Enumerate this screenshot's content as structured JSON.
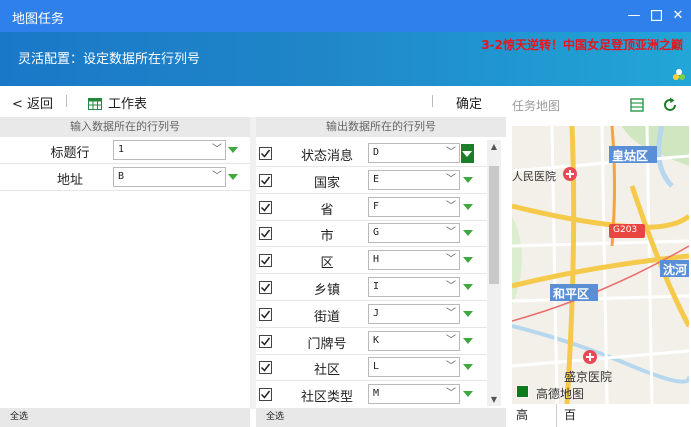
{
  "window": {
    "title": "地图任务"
  },
  "banner": {
    "subtitle": "灵活配置：设定数据所在行列号",
    "news": "3-2惊天逆转！中国女足登顶亚洲之巅"
  },
  "toolbar": {
    "back": "< 返回",
    "sheet": "工作表",
    "confirm": "确定"
  },
  "input": {
    "header": "输入数据所在的行列号",
    "rows": [
      {
        "label": "标题行",
        "value": "1"
      },
      {
        "label": "地址",
        "value": "B"
      }
    ],
    "footer": "全选"
  },
  "output": {
    "header": "输出数据所在的行列号",
    "rows": [
      {
        "label": "状态消息",
        "value": "D"
      },
      {
        "label": "国家",
        "value": "E"
      },
      {
        "label": "省",
        "value": "F"
      },
      {
        "label": "市",
        "value": "G"
      },
      {
        "label": "区",
        "value": "H"
      },
      {
        "label": "乡镇",
        "value": "I"
      },
      {
        "label": "街道",
        "value": "J"
      },
      {
        "label": "门牌号",
        "value": "K"
      },
      {
        "label": "社区",
        "value": "L"
      },
      {
        "label": "社区类型",
        "value": "M"
      }
    ],
    "footer": "全选"
  },
  "map": {
    "title": "任务地图",
    "labels": {
      "hospital1": "人民医院",
      "district1": "皇姑区",
      "road": "G203",
      "district2": "和平区",
      "district3": "沈河",
      "hospital2": "盛京医院",
      "brand": "高德地图"
    },
    "tabs": [
      "高",
      "百"
    ]
  },
  "colors": {
    "titlebar": "#2f80ea",
    "accent": "#1b7f2a",
    "news": "#e8151b"
  }
}
